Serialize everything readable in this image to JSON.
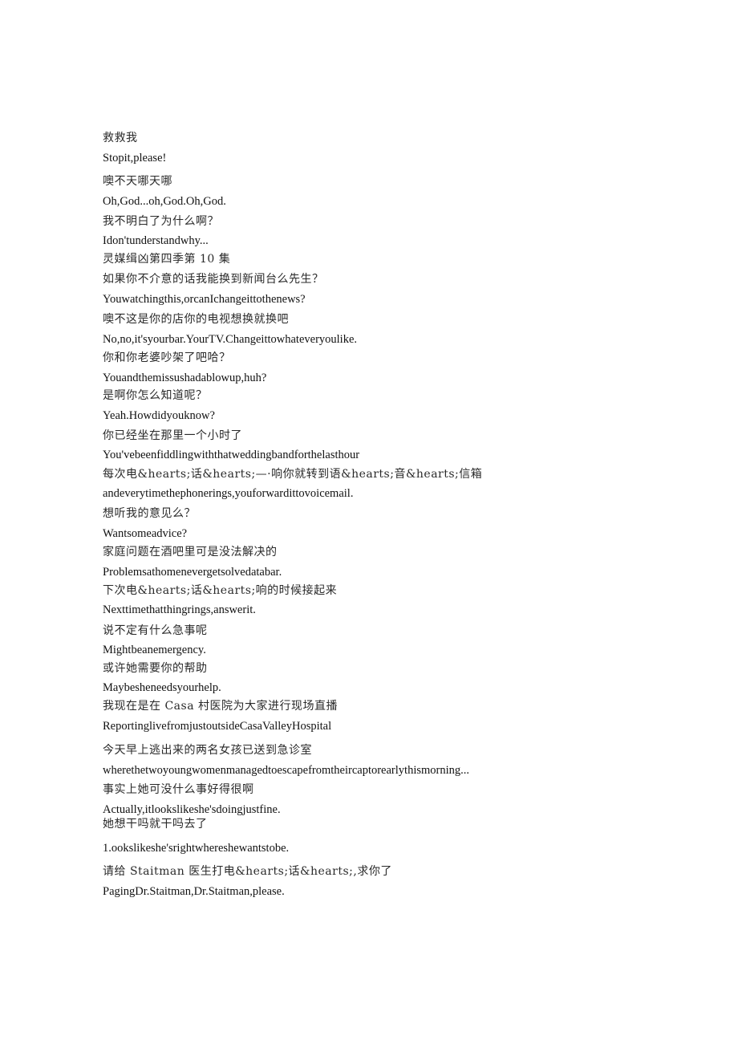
{
  "document": {
    "lines": [
      {
        "lang": "zh",
        "text": "救救我"
      },
      {
        "lang": "en",
        "text": "Stopit,please!"
      },
      {
        "lang": "zh",
        "text": "噢不天哪天哪"
      },
      {
        "lang": "en",
        "text": "Oh,God...oh,God.Oh,God."
      },
      {
        "lang": "zh",
        "text": "我不明白了为什么啊？"
      },
      {
        "lang": "en",
        "text": "Idon'tunderstandwhy..."
      },
      {
        "lang": "zh",
        "text": "灵媒缉凶第四季第 10 集"
      },
      {
        "lang": "zh",
        "text": "如果你不介意的话我能换到新闻台么先生？"
      },
      {
        "lang": "en",
        "text": "Youwatchingthis,orcanIchangeittothenews?"
      },
      {
        "lang": "zh",
        "text": "噢不这是你的店你的电视想换就换吧"
      },
      {
        "lang": "en",
        "text": "No,no,it'syourbar.YourTV.Changeittowhateveryoulike."
      },
      {
        "lang": "zh",
        "text": "你和你老婆吵架了吧哈？"
      },
      {
        "lang": "en",
        "text": "Youandthemissushadablowup,huh?"
      },
      {
        "lang": "zh",
        "text": "是啊你怎么知道呢？"
      },
      {
        "lang": "en",
        "text": "Yeah.Howdidyouknow?"
      },
      {
        "lang": "zh",
        "text": "你已经坐在那里一个小时了"
      },
      {
        "lang": "en",
        "text": "You'vebeenfiddlingwiththatweddingbandforthelasthour"
      },
      {
        "lang": "zh",
        "text": "每次电&hearts;话&hearts;—·响你就转到语&hearts;音&hearts;信箱"
      },
      {
        "lang": "en",
        "text": "andeverytimethephonerings,youforwardittovoicemail."
      },
      {
        "lang": "zh",
        "text": "想听我的意见么？"
      },
      {
        "lang": "en",
        "text": "Wantsomeadvice?"
      },
      {
        "lang": "zh",
        "text": "家庭问题在酒吧里可是没法解决的"
      },
      {
        "lang": "en",
        "text": "Problemsathomenevergetsolvedatabar."
      },
      {
        "lang": "zh",
        "text": "下次电&hearts;话&hearts;响的时候接起来"
      },
      {
        "lang": "en",
        "text": "Nexttimethatthingrings,answerit."
      },
      {
        "lang": "zh",
        "text": "说不定有什么急事呢"
      },
      {
        "lang": "en",
        "text": "Mightbeanemergency."
      },
      {
        "lang": "zh",
        "text": "或许她需要你的帮助"
      },
      {
        "lang": "en",
        "text": "Maybesheneedsyourhelp."
      },
      {
        "lang": "zh",
        "text": "我现在是在 Casa 村医院为大家进行现场直播"
      },
      {
        "lang": "en",
        "text": "ReportinglivefromjustoutsideCasaValleyHospital"
      },
      {
        "lang": "zh",
        "text": "今天早上逃出来的两名女孩已送到急诊室"
      },
      {
        "lang": "en",
        "text": "wherethetwoyoungwomenmanagedtoescapefromtheircaptorearlythismorning..."
      },
      {
        "lang": "zh",
        "text": "事实上她可没什么事好得很啊"
      },
      {
        "lang": "en",
        "text": "Actually,itlookslikeshe'sdoingjustfine."
      },
      {
        "lang": "zh",
        "text": "她想干吗就干吗去了"
      },
      {
        "lang": "en",
        "text": "1.ookslikeshe'srightwhereshewantstobe."
      },
      {
        "lang": "zh",
        "text": "请给 Staitman 医生打电&hearts;话&hearts;,求你了"
      },
      {
        "lang": "en",
        "text": "PagingDr.Staitman,Dr.Staitman,please."
      }
    ]
  }
}
